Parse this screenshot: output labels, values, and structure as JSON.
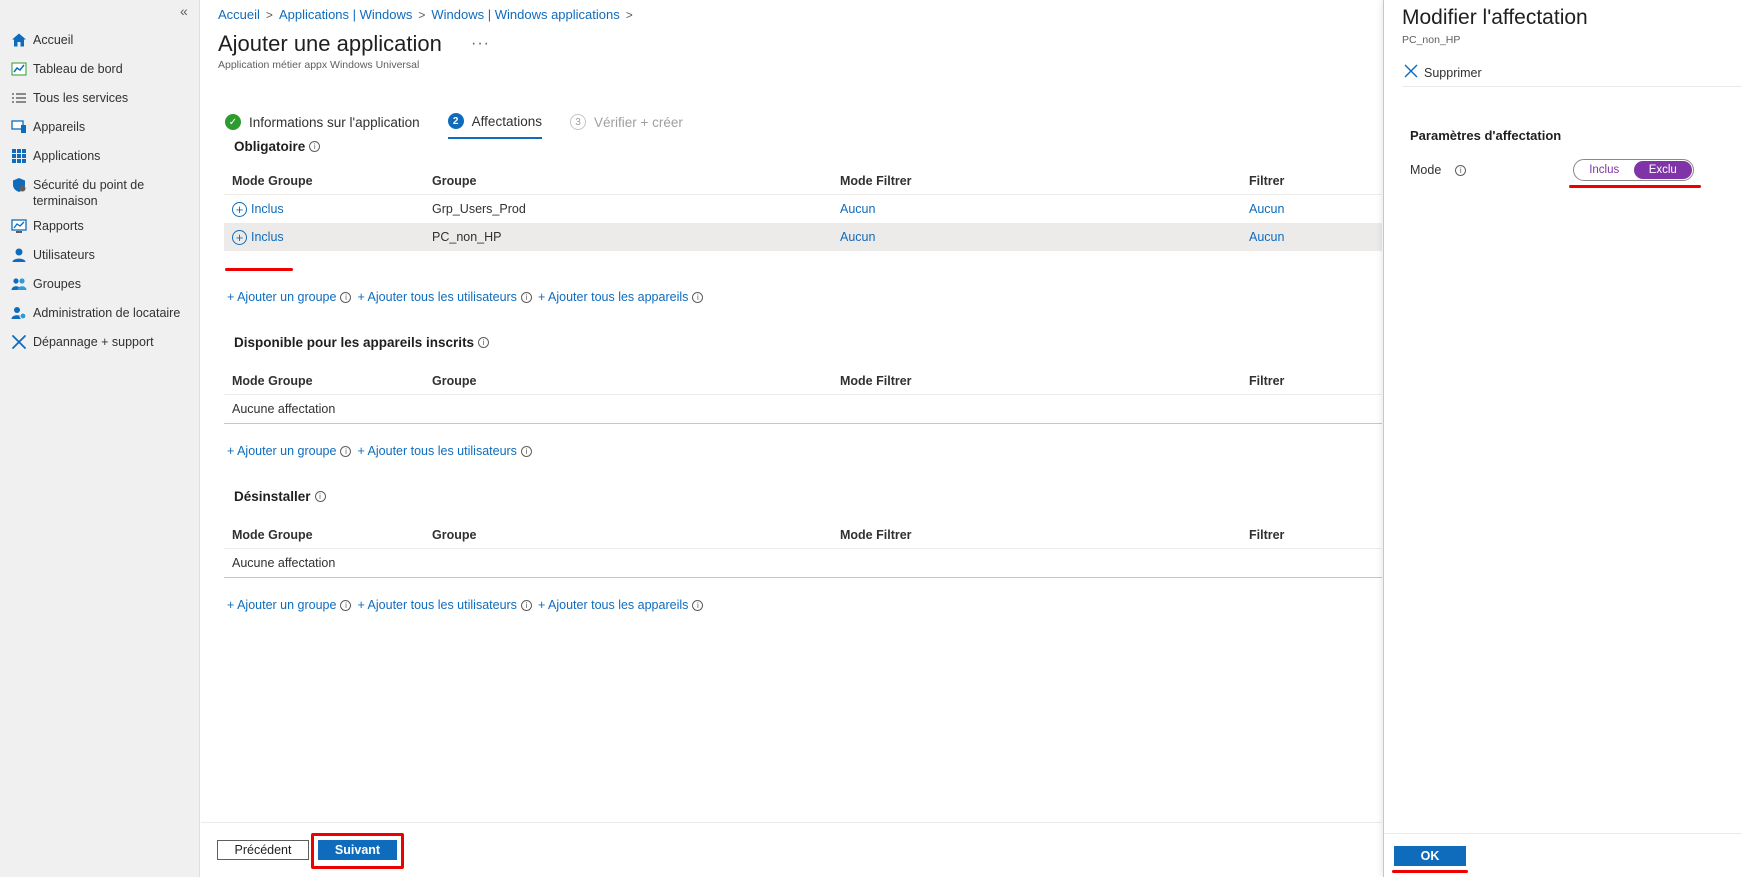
{
  "sidebar": {
    "collapse": "«",
    "items": [
      {
        "label": "Accueil",
        "icon": "home-icon"
      },
      {
        "label": "Tableau de bord",
        "icon": "dashboard-icon"
      },
      {
        "label": "Tous les services",
        "icon": "list-icon"
      },
      {
        "label": "Appareils",
        "icon": "devices-icon"
      },
      {
        "label": "Applications",
        "icon": "apps-grid-icon"
      },
      {
        "label": "Sécurité du point de terminaison",
        "icon": "shield-icon"
      },
      {
        "label": "Rapports",
        "icon": "reports-icon"
      },
      {
        "label": "Utilisateurs",
        "icon": "user-icon"
      },
      {
        "label": "Groupes",
        "icon": "groups-icon"
      },
      {
        "label": "Administration de locataire",
        "icon": "tenant-admin-icon"
      },
      {
        "label": "Dépannage + support",
        "icon": "troubleshoot-icon"
      }
    ]
  },
  "breadcrumb": [
    "Accueil",
    "Applications | Windows",
    "Windows | Windows applications"
  ],
  "page": {
    "title": "Ajouter une application",
    "more": "···",
    "subtitle": "Application métier appx Windows Universal"
  },
  "steps": [
    {
      "num": "✓",
      "label": "Informations sur l'application",
      "state": "done"
    },
    {
      "num": "2",
      "label": "Affectations",
      "state": "current"
    },
    {
      "num": "3",
      "label": "Vérifier + créer",
      "state": "todo"
    }
  ],
  "columns": [
    "Mode Groupe",
    "Groupe",
    "Mode Filtrer",
    "Filtrer"
  ],
  "sections": {
    "required": {
      "title": "Obligatoire",
      "rows": [
        {
          "mode": "Inclus",
          "group": "Grp_Users_Prod",
          "filter_mode": "Aucun",
          "filter": "Aucun"
        },
        {
          "mode": "Inclus",
          "group": "PC_non_HP",
          "filter_mode": "Aucun",
          "filter": "Aucun"
        }
      ]
    },
    "available": {
      "title": "Disponible pour les appareils inscrits",
      "empty": "Aucune affectation"
    },
    "uninstall": {
      "title": "Désinstaller",
      "empty": "Aucune affectation"
    }
  },
  "links": {
    "add_group": "+ Ajouter un groupe",
    "add_all_users": "+ Ajouter tous les utilisateurs",
    "add_all_devices": "+ Ajouter tous les appareils"
  },
  "footer": {
    "previous": "Précédent",
    "next": "Suivant"
  },
  "panel": {
    "title": "Modifier l'affectation",
    "subtitle": "PC_non_HP",
    "delete": "Supprimer",
    "section": "Paramètres d'affectation",
    "mode_label": "Mode",
    "mode_options": [
      "Inclus",
      "Exclu"
    ],
    "mode_selected": "Exclu",
    "ok": "OK"
  },
  "colors": {
    "accent": "#0f6cbd",
    "toggle": "#7f34a8",
    "annotation": "#e00000",
    "success": "#2e9b2e"
  }
}
